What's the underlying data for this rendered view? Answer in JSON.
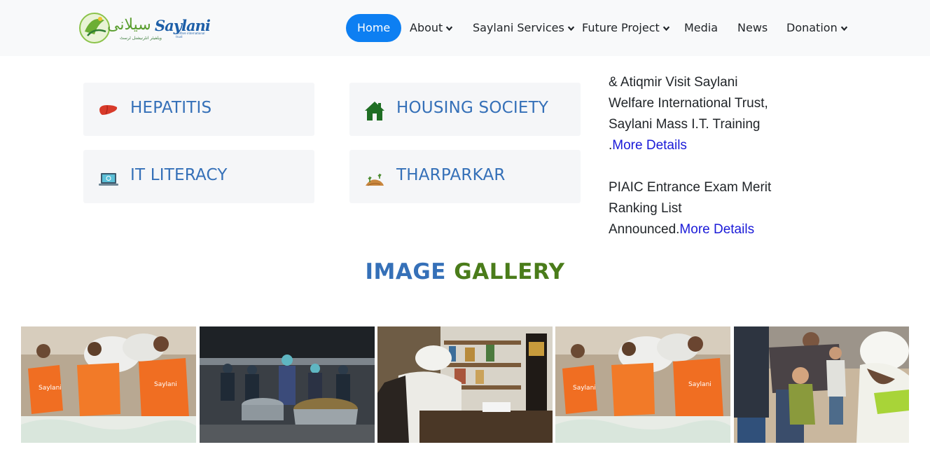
{
  "navbar": {
    "logo": {
      "arabic": "سیلانی",
      "latin": "Saylani",
      "tagline": "ویلفیئر انٹرنیشنل ٹرسٹ",
      "tagline_en": "welfare international trust"
    },
    "items": [
      {
        "label": "Home",
        "active": true,
        "dropdown": false
      },
      {
        "label": "About",
        "active": false,
        "dropdown": true
      },
      {
        "label": "Saylani Services",
        "active": false,
        "dropdown": true
      },
      {
        "label": "Future Project",
        "active": false,
        "dropdown": true
      },
      {
        "label": "Media",
        "active": false,
        "dropdown": false
      },
      {
        "label": "News",
        "active": false,
        "dropdown": false
      },
      {
        "label": "Donation",
        "active": false,
        "dropdown": true
      }
    ]
  },
  "services": [
    {
      "label": "HEPATITIS",
      "icon": "liver-icon"
    },
    {
      "label": "HOUSING SOCIETY",
      "icon": "house-icon"
    },
    {
      "label": "IT LITERACY",
      "icon": "laptop-icon"
    },
    {
      "label": "THARPARKAR",
      "icon": "desert-icon"
    }
  ],
  "news": [
    {
      "text": "& Atiqmir Visit Saylani Welfare International Trust, Saylani Mass I.T. Training .",
      "link": "More Details"
    },
    {
      "text": "PIAIC Entrance Exam Merit Ranking List Announced.",
      "link": "More Details"
    }
  ],
  "gallery": {
    "title_part1": "IMAGE",
    "title_part2": "GALLERY",
    "photos": [
      {
        "subject": "volunteers-carrying-sacks"
      },
      {
        "subject": "kitchen-cooking-pots"
      },
      {
        "subject": "cleric-at-desk"
      },
      {
        "subject": "volunteers-carrying-sacks"
      },
      {
        "subject": "cleric-with-children"
      }
    ]
  },
  "colors": {
    "accent": "#0d7ff2",
    "brand_blue": "#3570b8",
    "brand_green": "#4a7c1a",
    "link": "#1a1ad8",
    "nav_bg": "#f8f9fa",
    "card_bg": "#f5f6f8"
  }
}
